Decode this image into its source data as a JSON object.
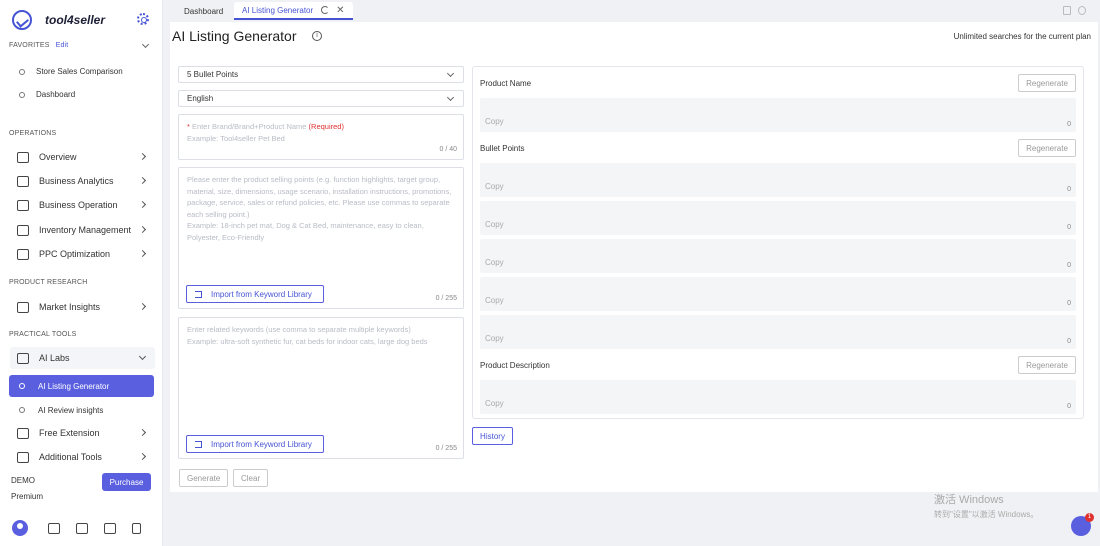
{
  "sidebar": {
    "logo_text": "tool4seller",
    "favorites_title": "FAVORITES",
    "favorites_edit": "Edit",
    "favorites": [
      "Store Sales Comparison",
      "Dashboard"
    ],
    "operations_title": "OPERATIONS",
    "operations": [
      "Overview",
      "Business Analytics",
      "Business Operation",
      "Inventory Management",
      "PPC Optimization"
    ],
    "product_research_title": "PRODUCT RESEARCH",
    "product_research": [
      "Market Insights"
    ],
    "practical_tools_title": "PRACTICAL TOOLS",
    "ai_labs": "AI Labs",
    "ai_labs_children": [
      "AI Listing Generator",
      "AI Review insights"
    ],
    "practical_tools_more": [
      "Free Extension",
      "Additional Tools"
    ],
    "account_name": "DEMO",
    "account_plan": "Premium",
    "purchase_label": "Purchase",
    "accent_color": "#5a5fe0"
  },
  "tabs": {
    "dashboard": "Dashboard",
    "active": "AI Listing Generator"
  },
  "main": {
    "title": "AI Listing Generator",
    "plan_note": "Unlimited searches for the current plan",
    "bullet_select": "5 Bullet Points",
    "language_select": "English",
    "product_name_placeholder": "Enter Brand/Brand+Product Name",
    "required_label": "(Required)",
    "product_name_example": "Example: Tool4seller Pet Bed",
    "product_name_count": "0 / 40",
    "selling_points_placeholder": "Please enter the product selling points (e.g. function highlights, target group, material, size, dimensions, usage scenario, installation instructions, promotions, package, service, sales or refund policies, etc. Please use commas to separate each selling point.)",
    "selling_points_example": "Example: 18-inch pet mat, Dog & Cat Bed, maintenance, easy to clean, Polyester, Eco-Friendly",
    "selling_points_count": "0 / 255",
    "keywords_placeholder": "Enter related keywords (use comma to separate multiple keywords)",
    "keywords_example": "Example: ultra-soft synthetic fur, cat beds for indoor cats, large dog beds",
    "keywords_count": "0 / 255",
    "import_label": "Import from Keyword Library",
    "generate_label": "Generate",
    "clear_label": "Clear",
    "history_label": "History"
  },
  "output": {
    "product_name_label": "Product Name",
    "bullet_points_label": "Bullet Points",
    "description_label": "Product Description",
    "regenerate_label": "Regenerate",
    "copy_label": "Copy",
    "count": "0"
  },
  "windows_watermark": {
    "line1": "激活 Windows",
    "line2": "转到\"设置\"以激活 Windows。"
  },
  "float_badge": "1"
}
